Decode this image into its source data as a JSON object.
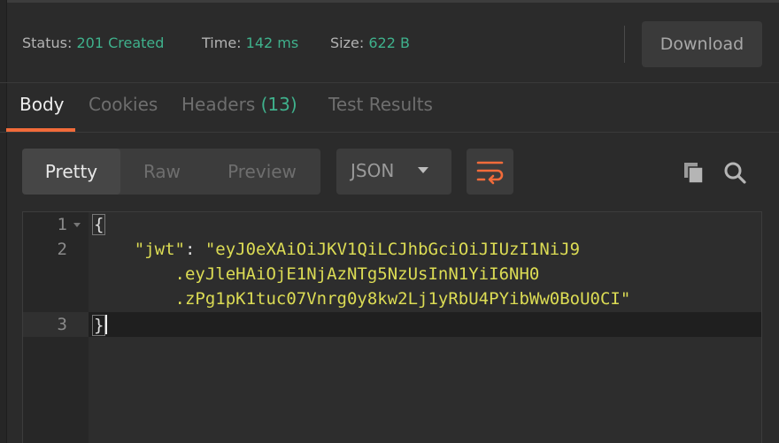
{
  "response_status": {
    "status_label": "Status:",
    "status_value": "201 Created",
    "time_label": "Time:",
    "time_value": "142 ms",
    "size_label": "Size:",
    "size_value": "622 B",
    "download_label": "Download"
  },
  "tabs": [
    {
      "label": "Body",
      "active": true
    },
    {
      "label": "Cookies"
    },
    {
      "label": "Headers",
      "count": "(13)"
    },
    {
      "label": "Test Results"
    }
  ],
  "view_modes": [
    "Pretty",
    "Raw",
    "Preview"
  ],
  "active_view_mode": "Pretty",
  "format_select": {
    "value": "JSON"
  },
  "icons": {
    "wrap": "wrap-lines-icon",
    "copy": "copy-icon",
    "search": "search-icon"
  },
  "colors": {
    "accent": "#f26b3a",
    "status_green": "#3fb18c",
    "json_string": "#dcdc54"
  },
  "editor": {
    "line_numbers": [
      "1",
      "2",
      "3"
    ],
    "open_brace": "{",
    "close_brace": "}",
    "key": "\"jwt\"",
    "colon": ": ",
    "value_lines": [
      "\"eyJ0eXAiOiJKV1QiLCJhbGciOiJIUzI1NiJ9",
      ".eyJleHAiOjE1NjAzNTg5NzUsInN1YiI6NH0",
      ".zPg1pK1tuc07Vnrg0y8kw2Lj1yRbU4PYibWw0BoU0CI\""
    ]
  }
}
